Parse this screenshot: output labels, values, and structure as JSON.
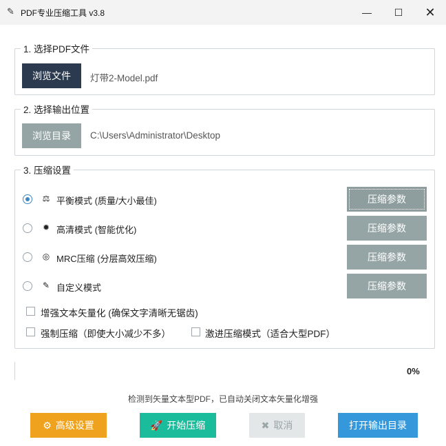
{
  "window": {
    "title": "PDF专业压缩工具 v3.8",
    "icon": "feather-icon",
    "min": "—",
    "max": "☐",
    "close": "✕"
  },
  "section1": {
    "legend": "1. 选择PDF文件",
    "browse_label": "浏览文件",
    "file_name": "灯带2-Model.pdf"
  },
  "section2": {
    "legend": "2. 选择输出位置",
    "browse_label": "浏览目录",
    "output_path": "C:\\Users\\Administrator\\Desktop"
  },
  "section3": {
    "legend": "3. 压缩设置",
    "modes": [
      {
        "label": "平衡模式 (质量/大小最佳)",
        "icon": "⚖",
        "selected": true
      },
      {
        "label": "高清模式 (智能优化)",
        "icon": "✹",
        "selected": false
      },
      {
        "label": "MRC压缩 (分层高效压缩)",
        "icon": "◎",
        "selected": false
      },
      {
        "label": "自定义模式",
        "icon": "✎",
        "selected": false
      }
    ],
    "param_button": "压缩参数",
    "options": {
      "vectorize": "增强文本矢量化 (确保文字清晰无锯齿)",
      "force": "强制压缩（即使大小减少不多）",
      "aggressive": "激进压缩模式（适合大型PDF）"
    }
  },
  "progress": {
    "value": 0,
    "text": "0%"
  },
  "status_message": "检测到矢量文本型PDF，已自动关闭文本矢量化增强",
  "actions": {
    "advanced": {
      "label": "高级设置",
      "icon": "⚙"
    },
    "start": {
      "label": "开始压缩",
      "icon": "🚀"
    },
    "cancel": {
      "label": "取消",
      "icon": "✖"
    },
    "open_output": {
      "label": "打开输出目录"
    }
  },
  "colors": {
    "dark_button": "#2b3a4e",
    "grey_button": "#95a5a6",
    "orange": "#efa21e",
    "teal": "#1bbc9b",
    "blue": "#3498db",
    "radio_accent": "#3c86c6"
  }
}
